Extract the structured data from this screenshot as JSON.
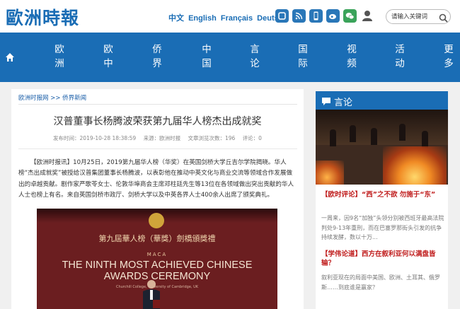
{
  "header": {
    "logo_text": "歐洲時報",
    "languages": [
      "中文",
      "English",
      "Français",
      "Deutsch"
    ],
    "social_icons": [
      "app-icon",
      "rss-icon",
      "mobile-icon",
      "weibo-icon",
      "wechat-icon",
      "user-icon"
    ],
    "search": {
      "placeholder": "请输入关键词"
    }
  },
  "nav": {
    "items": [
      "欧洲",
      "欧中",
      "侨界",
      "中国",
      "言论",
      "国际",
      "视频",
      "活动",
      "更多"
    ]
  },
  "breadcrumb": {
    "site": "欧洲时报网",
    "separator": ">>",
    "section": "侨界新闻"
  },
  "article": {
    "title": "汉普董事长杨腾波荣获第九届华人榜杰出成就奖",
    "meta": {
      "published": "发布时间：2019-10-28 18:38:59",
      "source": "来源：欧洲时报",
      "views": "文章浏览次数：196",
      "comments": "评论：0"
    },
    "body": "【欧洲时报讯】10月25日，2019第九届华人榜（华奖）在英国剑桥大学丘吉尔学院揭晓。华人榜“杰出成就奖”被授给汉普集团董事长杨腾波，以表彰他在推动中英文化与商业交流等领域合作发展做出的卓越贡献。剧作家严歌苓女士、伦敦华埠商会主席邓柱廷先生等13位在各领域做出突出贡献的华人人士也榜上有名。来自英国剑桥市政厅、剑桥大学以及中英各界人士400余人出席了颁奖典礼。",
    "photo": {
      "cn_title": "第九屆華人榜（華獎）劍橋頒獎禮",
      "maca": "MACA",
      "en_line1": "THE NINTH MOST ACHIEVED CHINESE",
      "en_line2": "AWARDS CEREMONY",
      "venue": "Churchill College, University of Cambridge, UK"
    }
  },
  "sidebar": {
    "section_title": "言论",
    "items": [
      {
        "headline": "【欧时评论】“西”之不欲 勿施于“东”",
        "summary": "一周来，因9名“加独”头领分别被西班牙最高法院判处9-13年重刑，而在巴塞罗那街头引发的抗争持续发酵，数以十万..."
      },
      {
        "headline": "【学伟论道】西方在叙利亚何以满盘皆输？",
        "summary": "叙利亚现在的局面中美国、欧洲、土耳其、俄罗斯……到底谁是赢家？"
      }
    ]
  }
}
